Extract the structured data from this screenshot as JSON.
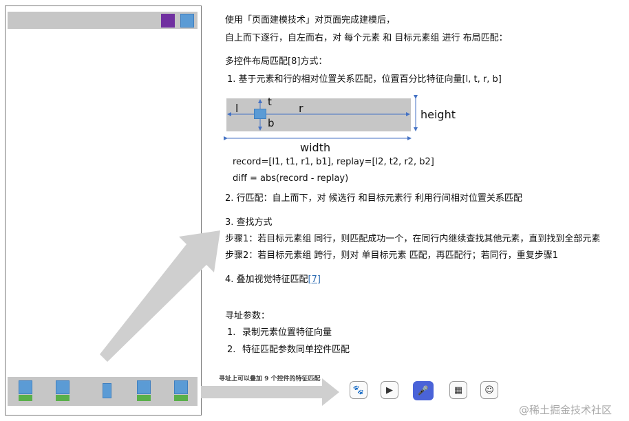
{
  "colors": {
    "bar_gray": "#c6c6c6",
    "purple": "#7030a0",
    "blue": "#5b9bd5",
    "green": "#59b04a",
    "link": "#2f6db3",
    "arrow_gray": "#cfcfcf"
  },
  "text": {
    "intro1": "使用「页面建模技术」对页面完成建模后，",
    "intro2": "自上而下逐行，自左而右，对 每个元素 和 目标元素组 进行 布局匹配：",
    "multi_title": "多控件布局匹配[8]方式：",
    "step1": "1. 基于元素和行的相对位置关系匹配，位置百分比特征向量[l, t, r, b]",
    "record": "record=[l1, t1, r1, b1], replay=[l2, t2, r2, b2]",
    "diff": "diff = abs(record - replay)",
    "step2": "2. 行匹配：自上而下，对 候选行 和目标元素行 利用行间相对位置关系匹配",
    "step3": "3. 查找方式",
    "sub1": "步骤1：若目标元素组 同行，则匹配成功一个，在同行内继续查找其他元素，直到找到全部元素",
    "sub2": "步骤2：若目标元素组 跨行，则对 单目标元素 匹配，再匹配行；若同行，重复步骤1",
    "step4": "4. 叠加视觉特征匹配",
    "step4_ref": "[7]",
    "addr_title": "寻址参数：",
    "addr1_num": "1.",
    "addr1": "录制元素位置特征向量",
    "addr2_num": "2.",
    "addr2": "特征匹配参数同单控件匹配",
    "bottom_caption": "寻址上可以叠加 9 个控件的特征匹配",
    "watermark": "@稀土掘金技术社区"
  },
  "diagram": {
    "l": "l",
    "t": "t",
    "r": "r",
    "b": "b",
    "height": "height",
    "width": "width"
  },
  "icons": [
    "paw-icon",
    "play-icon",
    "mic-icon",
    "calendar-icon",
    "smile-icon"
  ]
}
